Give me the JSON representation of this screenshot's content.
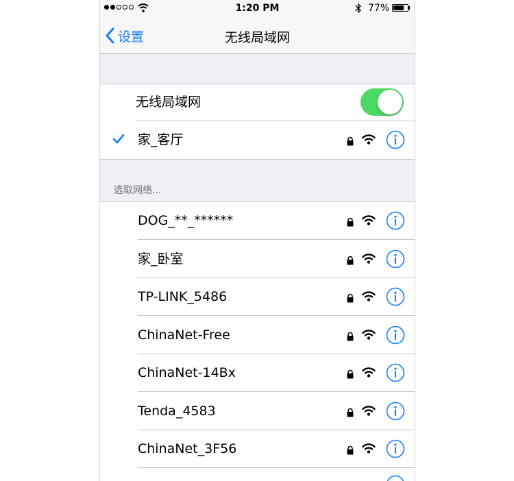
{
  "status_bar": {
    "time": "1:20 PM",
    "battery_percent": "77%",
    "battery_level": 0.77,
    "signal_bars_filled": 2,
    "signal_bars_total": 5,
    "icons": [
      "signal-dots-icon",
      "wifi-icon",
      "bluetooth-icon",
      "battery-icon"
    ]
  },
  "nav": {
    "back_label": "设置",
    "title": "无线局域网"
  },
  "wifi_toggle": {
    "label": "无线局域网",
    "on": true
  },
  "connected": {
    "name": "家_客厅",
    "secured": true
  },
  "section_header": "选取网络...",
  "networks": [
    {
      "name": "DOG_**_******",
      "secured": true
    },
    {
      "name": "家_卧室",
      "secured": true
    },
    {
      "name": "TP-LINK_5486",
      "secured": true
    },
    {
      "name": "ChinaNet-Free",
      "secured": true
    },
    {
      "name": "ChinaNet-14Bx",
      "secured": true
    },
    {
      "name": "Tenda_4583",
      "secured": true
    },
    {
      "name": "ChinaNet_3F56",
      "secured": true
    }
  ],
  "colors": {
    "accent": "#147efb",
    "toggle_on": "#4cd964",
    "group_bg": "#efeff4",
    "bar_bg": "#f7f7f7"
  }
}
